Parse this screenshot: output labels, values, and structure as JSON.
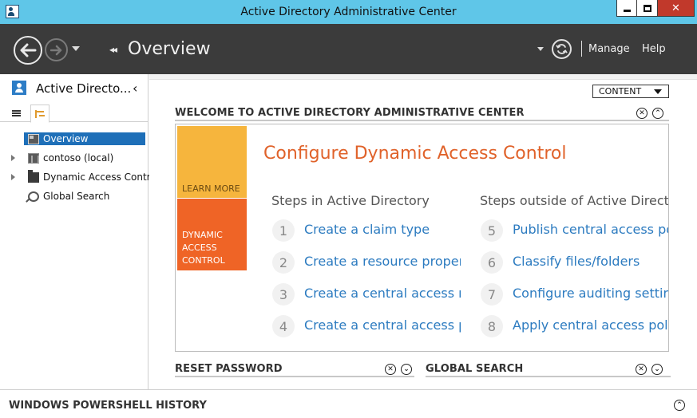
{
  "window": {
    "title": "Active Directory Administrative Center"
  },
  "header": {
    "breadcrumb_title": "Overview",
    "manage_label": "Manage",
    "help_label": "Help"
  },
  "navigation_pane": {
    "title": "Active Directo...",
    "items": [
      {
        "label": "Overview",
        "selected": true,
        "icon": "overview-icon",
        "expandable": false
      },
      {
        "label": "contoso (local)",
        "selected": false,
        "icon": "domain-icon",
        "expandable": true
      },
      {
        "label": "Dynamic Access Control",
        "selected": false,
        "icon": "folder-icon",
        "expandable": true
      },
      {
        "label": "Global Search",
        "selected": false,
        "icon": "search-icon",
        "expandable": false
      }
    ]
  },
  "main": {
    "content_button": "CONTENT",
    "welcome": {
      "section_title": "WELCOME TO ACTIVE DIRECTORY ADMINISTRATIVE CENTER",
      "tile_learn_more": "LEARN MORE",
      "tile_dac_lines": [
        "DYNAMIC",
        "ACCESS",
        "CONTROL"
      ],
      "heading": "Configure Dynamic Access Control",
      "col_in_ad": "Steps in Active Directory",
      "col_outside_ad": "Steps outside of Active Directo",
      "steps_in_ad": [
        {
          "num": "1",
          "label": "Create a claim type"
        },
        {
          "num": "2",
          "label": "Create a resource proper"
        },
        {
          "num": "3",
          "label": "Create a central access ru"
        },
        {
          "num": "4",
          "label": "Create a central access po"
        }
      ],
      "steps_outside_ad": [
        {
          "num": "5",
          "label": "Publish central access po"
        },
        {
          "num": "6",
          "label": "Classify files/folders"
        },
        {
          "num": "7",
          "label": "Configure auditing setting"
        },
        {
          "num": "8",
          "label": "Apply central access polic"
        }
      ]
    },
    "reset_password": {
      "section_title": "RESET PASSWORD"
    },
    "global_search": {
      "section_title": "GLOBAL SEARCH"
    }
  },
  "powershell_history": {
    "title": "WINDOWS POWERSHELL HISTORY"
  },
  "colors": {
    "titlebar": "#5fc6e8",
    "header": "#3b3b3b",
    "selection": "#1e6fb8",
    "tile_learn": "#f6b53d",
    "tile_dac": "#ef6426",
    "heading_orange": "#e0622a",
    "link_blue": "#2c7bc0"
  }
}
